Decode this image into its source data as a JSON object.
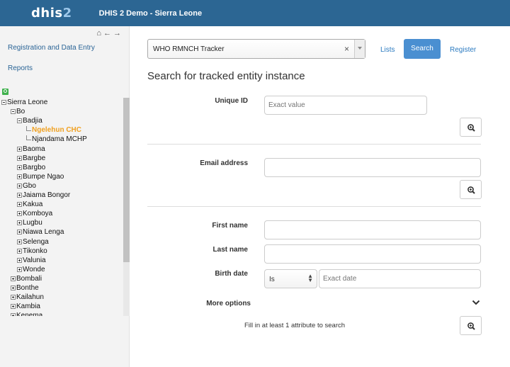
{
  "header": {
    "logo_main": "dhis",
    "logo_num": "2",
    "title": "DHIS 2 Demo - Sierra Leone"
  },
  "sidebar": {
    "nav_icons": [
      "home-icon",
      "arrow-left-icon",
      "arrow-right-icon"
    ],
    "links": [
      "Registration and Data Entry",
      "Reports"
    ]
  },
  "tree": [
    {
      "label": "Sierra Leone",
      "state": "open",
      "level": 0
    },
    {
      "label": "Bo",
      "state": "open",
      "level": 1
    },
    {
      "label": "Badjia",
      "state": "open",
      "level": 2
    },
    {
      "label": "Ngelehun CHC",
      "state": "leaf",
      "level": 3,
      "selected": true
    },
    {
      "label": "Njandama MCHP",
      "state": "leaf",
      "level": 3
    },
    {
      "label": "Baoma",
      "state": "closed",
      "level": 2
    },
    {
      "label": "Bargbe",
      "state": "closed",
      "level": 2
    },
    {
      "label": "Bargbo",
      "state": "closed",
      "level": 2
    },
    {
      "label": "Bumpe Ngao",
      "state": "closed",
      "level": 2
    },
    {
      "label": "Gbo",
      "state": "closed",
      "level": 2
    },
    {
      "label": "Jaiama Bongor",
      "state": "closed",
      "level": 2
    },
    {
      "label": "Kakua",
      "state": "closed",
      "level": 2
    },
    {
      "label": "Komboya",
      "state": "closed",
      "level": 2
    },
    {
      "label": "Lugbu",
      "state": "closed",
      "level": 2
    },
    {
      "label": "Niawa Lenga",
      "state": "closed",
      "level": 2
    },
    {
      "label": "Selenga",
      "state": "closed",
      "level": 2
    },
    {
      "label": "Tikonko",
      "state": "closed",
      "level": 2
    },
    {
      "label": "Valunia",
      "state": "closed",
      "level": 2
    },
    {
      "label": "Wonde",
      "state": "closed",
      "level": 2
    },
    {
      "label": "Bombali",
      "state": "closed",
      "level": 1
    },
    {
      "label": "Bonthe",
      "state": "closed",
      "level": 1
    },
    {
      "label": "Kailahun",
      "state": "closed",
      "level": 1
    },
    {
      "label": "Kambia",
      "state": "closed",
      "level": 1
    },
    {
      "label": "Kenema",
      "state": "closed",
      "level": 1
    }
  ],
  "program_select": {
    "value": "WHO RMNCH Tracker",
    "clear": "×"
  },
  "nav": {
    "lists": "Lists",
    "search": "Search",
    "register": "Register"
  },
  "heading": "Search for tracked entity instance",
  "form": {
    "unique_id_label": "Unique ID",
    "unique_id_placeholder": "Exact value",
    "email_label": "Email address",
    "first_name_label": "First name",
    "last_name_label": "Last name",
    "birth_date_label": "Birth date",
    "birth_operator": "Is",
    "birth_placeholder": "Exact date",
    "more_options": "More options",
    "hint": "Fill in at least 1 attribute to search"
  }
}
